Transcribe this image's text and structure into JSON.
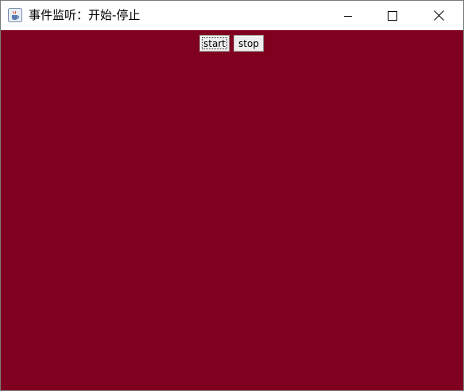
{
  "window": {
    "title": "事件监听：开始-停止"
  },
  "controls": {
    "start_label": "start",
    "stop_label": "stop"
  },
  "colors": {
    "panel_background": "#800020",
    "titlebar_background": "#ffffff"
  },
  "icons": {
    "app": "java-coffee-cup-icon",
    "minimize": "minimize-icon",
    "maximize": "maximize-icon",
    "close": "close-icon"
  }
}
